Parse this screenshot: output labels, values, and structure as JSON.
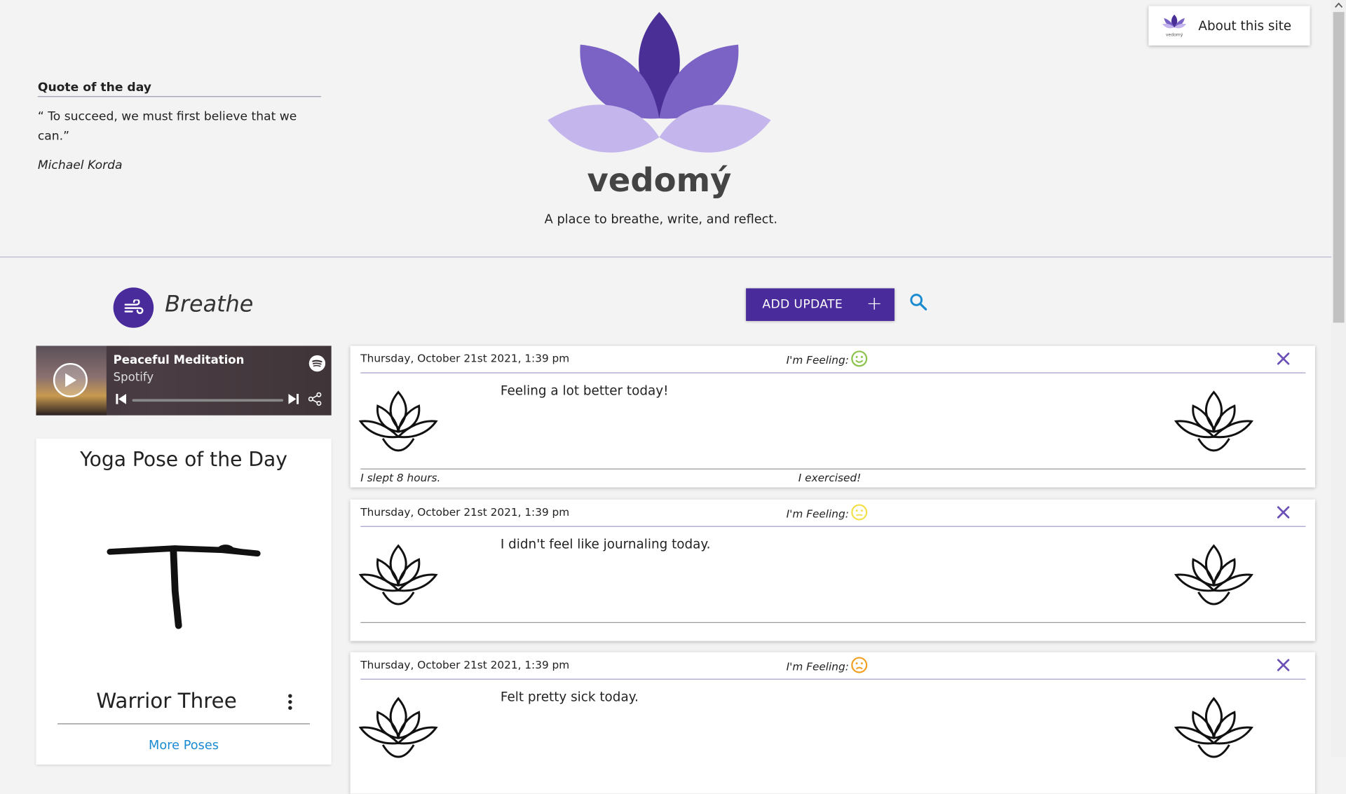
{
  "about": {
    "label": "About this site",
    "logo_small_text": "vedomý"
  },
  "quote": {
    "title": "Quote of the day",
    "text": "“ To succeed, we must first believe that we can.”",
    "author": "Michael Korda"
  },
  "brand": {
    "name": "vedomý",
    "tagline": "A place to breathe, write, and reflect."
  },
  "breathe": {
    "label": "Breathe"
  },
  "toolbar": {
    "add_label": "ADD UPDATE",
    "add_icon": "plus-icon",
    "search_icon": "search-icon"
  },
  "player": {
    "title": "Peaceful Meditation",
    "subtitle": "Spotify"
  },
  "yoga": {
    "heading": "Yoga Pose of the Day",
    "pose": "Warrior Three",
    "more": "More Poses"
  },
  "entries": [
    {
      "date": "Thursday, October 21st 2021, 1:39 pm",
      "feeling_label": "I'm Feeling:",
      "mood": "happy",
      "mood_color": "#8bc34a",
      "text": "Feeling a lot better today!",
      "foot_left": "I slept 8 hours.",
      "foot_right": "I exercised!"
    },
    {
      "date": "Thursday, October 21st 2021, 1:39 pm",
      "feeling_label": "I'm Feeling:",
      "mood": "neutral",
      "mood_color": "#f2e04a",
      "text": "I didn't feel like journaling today.",
      "foot_left": "",
      "foot_right": ""
    },
    {
      "date": "Thursday, October 21st 2021, 1:39 pm",
      "feeling_label": "I'm Feeling:",
      "mood": "sad",
      "mood_color": "#f0a020",
      "text": "Felt pretty sick today.",
      "foot_left": "",
      "foot_right": ""
    }
  ],
  "colors": {
    "accent": "#4a2b9b",
    "link": "#1a8ad1",
    "lotus_dark": "#4a2f96",
    "lotus_mid": "#7a63c4",
    "lotus_light": "#c4b5ec"
  }
}
